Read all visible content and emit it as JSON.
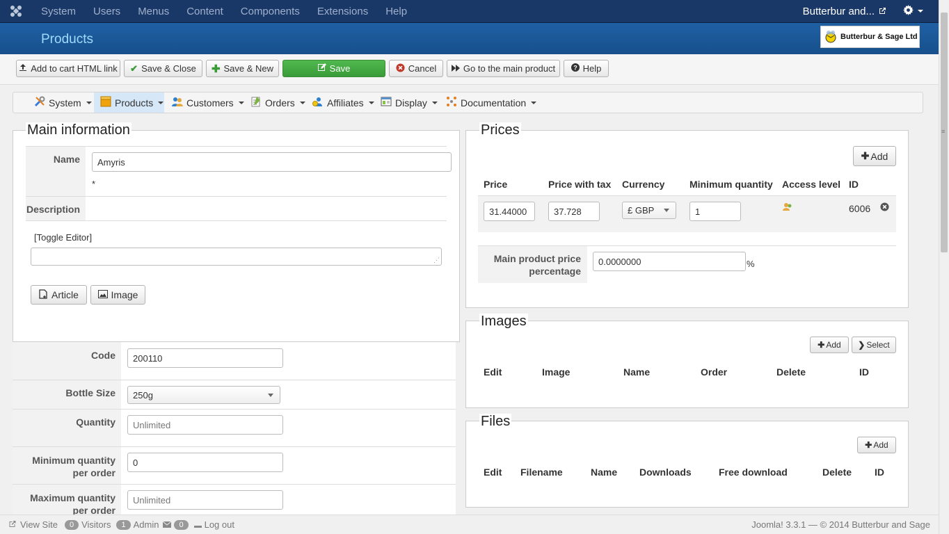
{
  "topnav": {
    "menu": [
      "System",
      "Users",
      "Menus",
      "Content",
      "Components",
      "Extensions",
      "Help"
    ],
    "site_name": "Butterbur and...",
    "icons": {
      "logo": "joomla-icon",
      "external": "external-link-icon",
      "gear": "gear-icon"
    }
  },
  "header": {
    "title": "Products",
    "brand": "Butterbur & Sage Ltd"
  },
  "toolbar": {
    "add_to_cart": "Add to cart HTML link",
    "save_close": "Save & Close",
    "save_new": "Save & New",
    "save": "Save",
    "cancel": "Cancel",
    "main_product": "Go to the main product",
    "help": "Help"
  },
  "submenu": [
    "System",
    "Products",
    "Customers",
    "Orders",
    "Affiliates",
    "Display",
    "Documentation"
  ],
  "main_info": {
    "legend": "Main information",
    "name_label": "Name",
    "name_value": "Amyris",
    "required": "*",
    "description_label": "Description",
    "toggle_editor": "[Toggle Editor]",
    "article_btn": "Article",
    "image_btn": "Image"
  },
  "fields": {
    "code_label": "Code",
    "code_value": "200110",
    "bottle_label": "Bottle Size",
    "bottle_value": "250g",
    "quantity_label": "Quantity",
    "quantity_placeholder": "Unlimited",
    "minq_label": "Minimum quantity per order",
    "minq_value": "0",
    "maxq_label": "Maximum quantity per order",
    "maxq_placeholder": "Unlimited"
  },
  "prices": {
    "legend": "Prices",
    "add": "Add",
    "headers": [
      "Price",
      "Price with tax",
      "Currency",
      "Minimum quantity",
      "Access level",
      "ID"
    ],
    "row": {
      "price": "31.44000",
      "price_tax": "37.728",
      "currency": "£ GBP",
      "min_qty": "1",
      "id": "6006"
    },
    "main_pct_label": "Main product price percentage",
    "main_pct_value": "0.0000000",
    "pct": "%"
  },
  "images": {
    "legend": "Images",
    "add": "Add",
    "select": "Select",
    "headers": [
      "Edit",
      "Image",
      "Name",
      "Order",
      "Delete",
      "ID"
    ]
  },
  "files": {
    "legend": "Files",
    "add": "Add",
    "headers": [
      "Edit",
      "Filename",
      "Name",
      "Downloads",
      "Free download",
      "Delete",
      "ID"
    ]
  },
  "footer": {
    "view_site": "View Site",
    "visitors_count": "0",
    "visitors": "Visitors",
    "admin_count": "1",
    "admin": "Admin",
    "msg_count": "0",
    "logout": "Log out",
    "copyright": "Joomla! 3.3.1 — © 2014 Butterbur and Sage"
  }
}
